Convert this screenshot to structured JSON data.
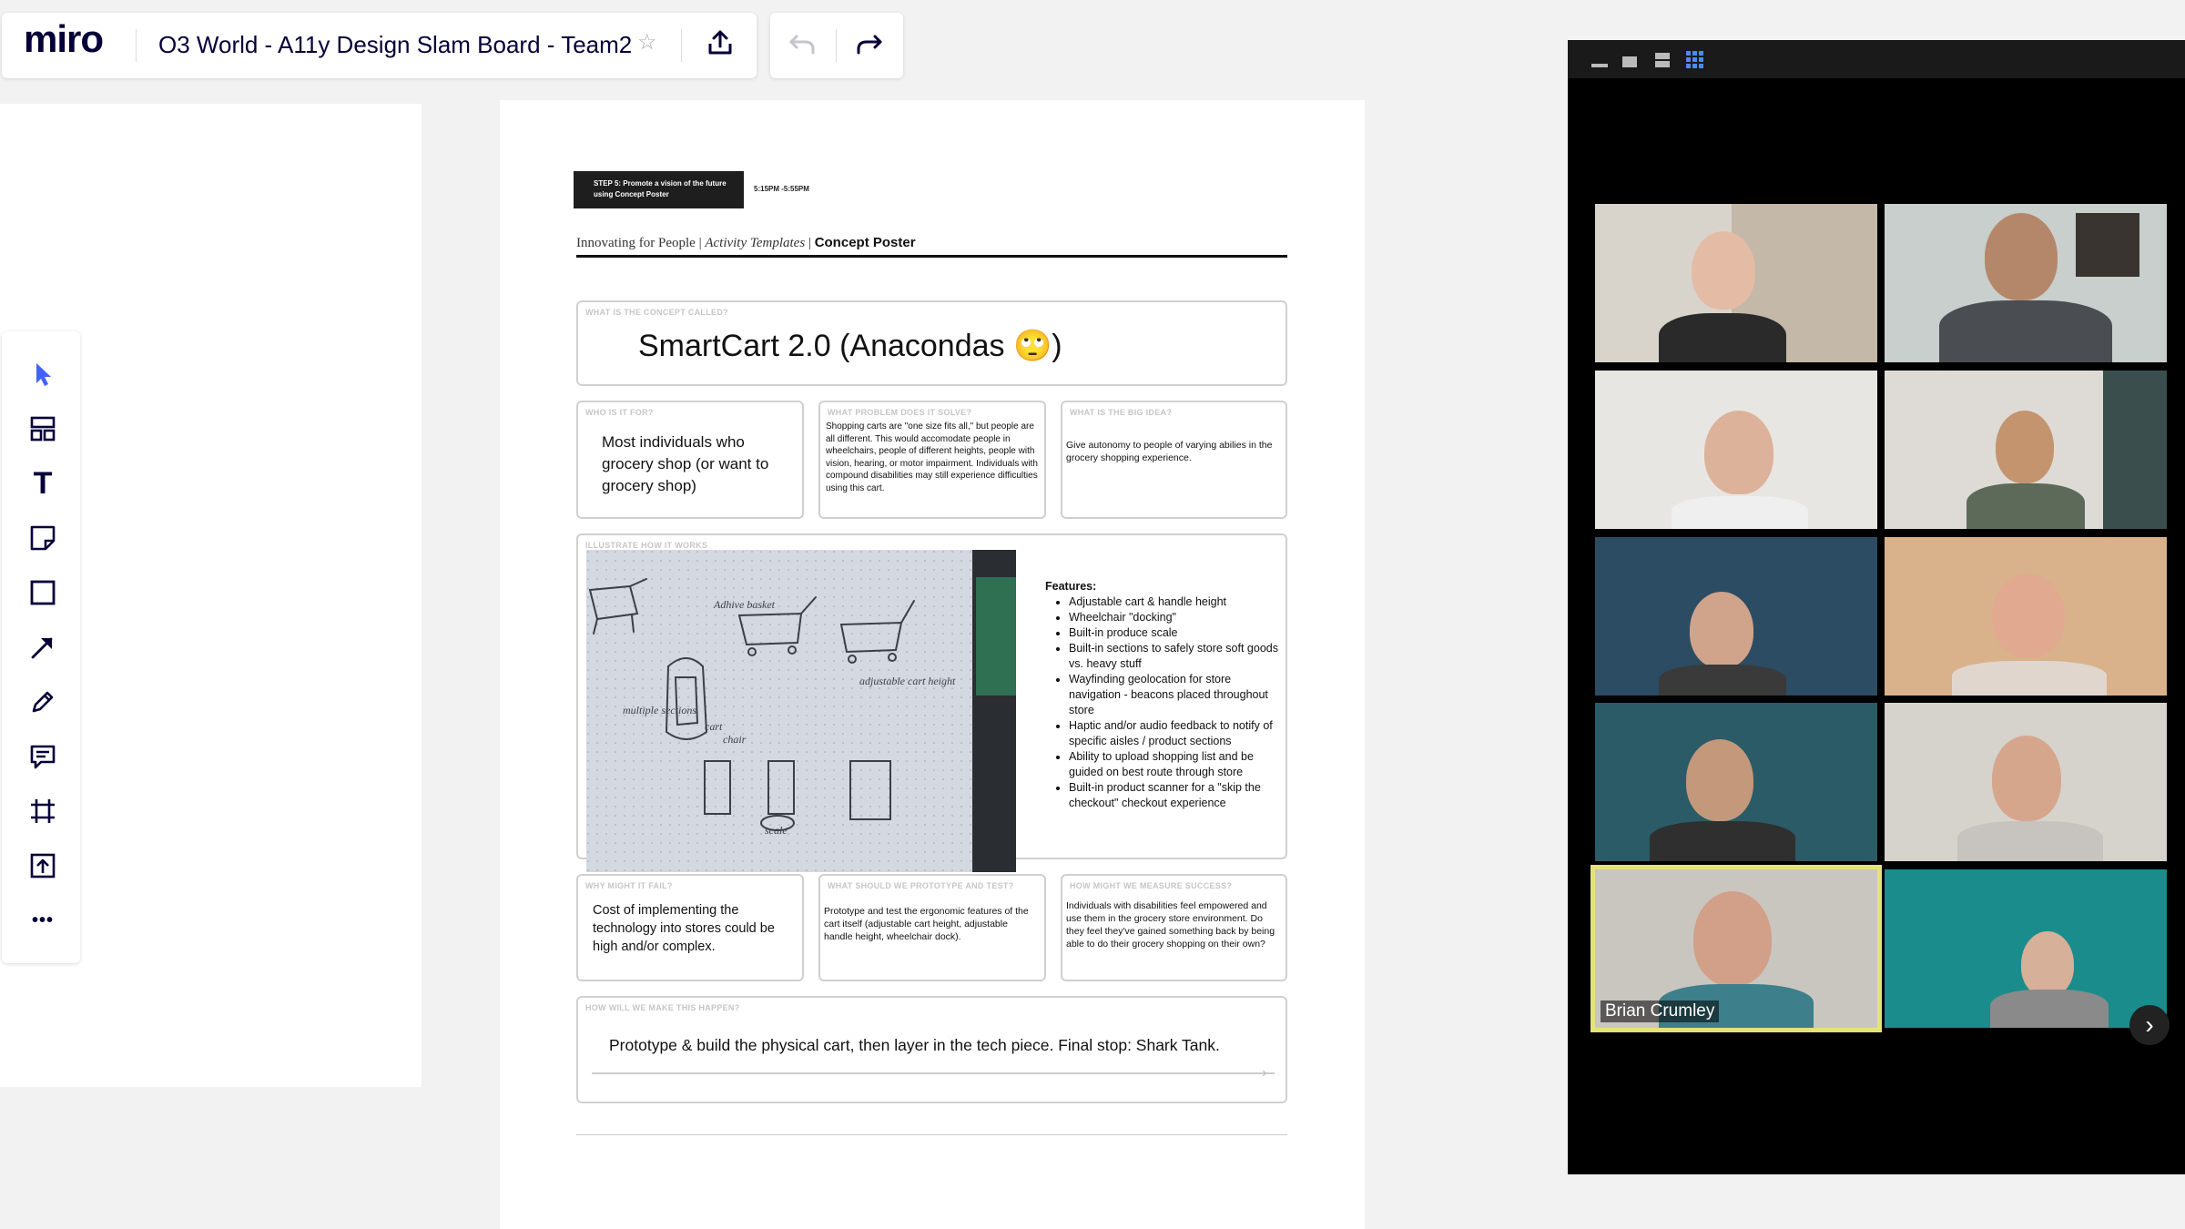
{
  "app": {
    "logo": "miro",
    "board_title": "O3 World - A11y Design Slam Board - Team2"
  },
  "toolbar": {
    "tools": [
      {
        "name": "select-tool",
        "icon": "cursor-icon"
      },
      {
        "name": "templates-tool",
        "icon": "templates-icon"
      },
      {
        "name": "text-tool",
        "icon": "text-icon",
        "glyph": "T"
      },
      {
        "name": "sticky-note-tool",
        "icon": "sticky-note-icon"
      },
      {
        "name": "shape-tool",
        "icon": "square-icon"
      },
      {
        "name": "line-tool",
        "icon": "arrow-icon"
      },
      {
        "name": "pen-tool",
        "icon": "pen-icon"
      },
      {
        "name": "comment-tool",
        "icon": "comment-icon"
      },
      {
        "name": "frame-tool",
        "icon": "frame-icon"
      },
      {
        "name": "upload-tool",
        "icon": "upload-icon"
      },
      {
        "name": "more-tools",
        "icon": "more-icon",
        "glyph": "•••"
      }
    ],
    "accent": "#4262ff"
  },
  "poster": {
    "step_label": "STEP 5: Promote a vision of the future using Concept Poster",
    "step_time": "5:15PM -5:55PM",
    "crumb_1": "Innovating for People",
    "crumb_2": "Activity Templates",
    "crumb_3": "Concept Poster",
    "concept": {
      "label": "WHAT IS THE CONCEPT CALLED?",
      "value": "SmartCart 2.0 (Anacondas 🙄)"
    },
    "who": {
      "label": "WHO IS IT FOR?",
      "value": "Most individuals who grocery shop (or want to grocery shop)"
    },
    "problem": {
      "label": "WHAT PROBLEM DOES IT SOLVE?",
      "value": "Shopping carts are \"one size fits all,\" but people are all different.  This would accomodate people in wheelchairs, people of different heights, people with vision, hearing, or motor impairment. Individuals with compound disabilities may still experience difficulties using this cart."
    },
    "idea": {
      "label": "WHAT IS THE BIG IDEA?",
      "value": "Give autonomy to people of varying abilies in the grocery shopping experience."
    },
    "illustrate": {
      "label": "ILLUSTRATE HOW IT WORKS"
    },
    "features_title": "Features:",
    "features": [
      "Adjustable cart & handle height",
      "Wheelchair \"docking\"",
      "Built-in produce scale",
      "Built-in sections to safely store soft goods vs. heavy stuff",
      "Wayfinding geolocation for store navigation - beacons placed throughout store",
      "Haptic and/or audio feedback to notify of specific aisles / product sections",
      "Ability to upload shopping list and be guided on best route through store",
      "Built-in product scanner for a \"skip the checkout\" checkout experience"
    ],
    "fail": {
      "label": "WHY MIGHT IT FAIL?",
      "value": "Cost of implementing the technology into stores could be high and/or complex."
    },
    "prototype": {
      "label": "WHAT SHOULD WE PROTOTYPE AND TEST?",
      "value": "Prototype and test the ergonomic features of the cart itself (adjustable cart height, adjustable handle height, wheelchair dock)."
    },
    "measure": {
      "label": "HOW MIGHT WE MEASURE SUCCESS?",
      "value": "Individuals with disabilities feel empowered and use them in the grocery store environment.  Do they feel they've gained something back by being able to do their grocery shopping on their own?"
    },
    "happen": {
      "label": "HOW WILL WE MAKE THIS HAPPEN?",
      "value": "Prototype & build the physical cart, then layer in the tech piece.  Final stop: Shark Tank."
    }
  },
  "video_call": {
    "active_speaker": "Brian Crumley",
    "highlight_color": "#e4e37a",
    "participants": 10
  }
}
